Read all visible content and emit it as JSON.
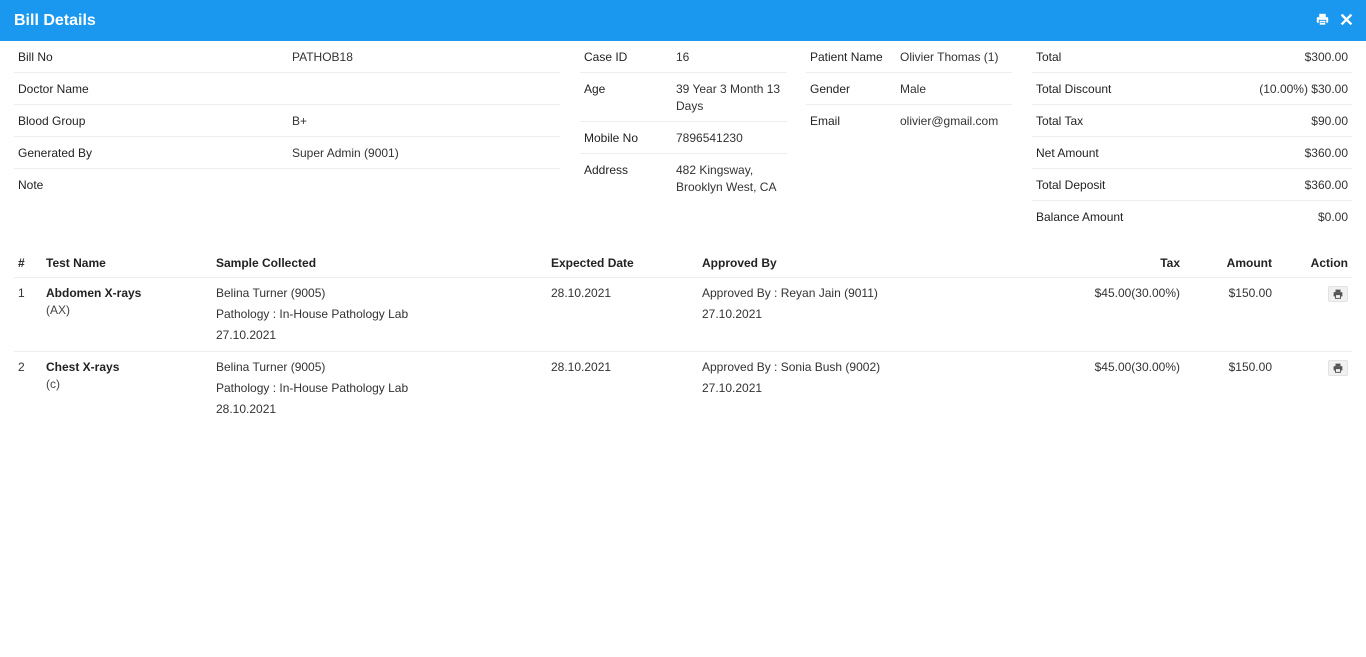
{
  "modal": {
    "title": "Bill Details"
  },
  "icons": {
    "print": "print-icon",
    "close": "close-icon"
  },
  "colors": {
    "header": "#1a98f0"
  },
  "bill_info": [
    {
      "label": "Bill No",
      "value": "PATHOB18"
    },
    {
      "label": "Doctor Name",
      "value": ""
    },
    {
      "label": "Blood Group",
      "value": "B+"
    },
    {
      "label": "Generated By",
      "value": "Super Admin (9001)"
    },
    {
      "label": "Note",
      "value": ""
    }
  ],
  "case_info": [
    {
      "label": "Case ID",
      "value": "16"
    },
    {
      "label": "Age",
      "value": "39 Year 3 Month 13 Days"
    },
    {
      "label": "Mobile No",
      "value": "7896541230"
    },
    {
      "label": "Address",
      "value": "482 Kingsway, Brooklyn West, CA"
    }
  ],
  "patient_info": [
    {
      "label": "Patient Name",
      "value": "Olivier Thomas (1)"
    },
    {
      "label": "Gender",
      "value": "Male"
    },
    {
      "label": "Email",
      "value": "olivier@gmail.com"
    }
  ],
  "totals": [
    {
      "label": "Total",
      "value": "$300.00"
    },
    {
      "label": "Total Discount",
      "value": "(10.00%) $30.00"
    },
    {
      "label": "Total Tax",
      "value": "$90.00"
    },
    {
      "label": "Net Amount",
      "value": "$360.00"
    },
    {
      "label": "Total Deposit",
      "value": "$360.00"
    },
    {
      "label": "Balance Amount",
      "value": "$0.00"
    }
  ],
  "tests": {
    "headers": {
      "num": "#",
      "test_name": "Test Name",
      "sample": "Sample Collected",
      "expected": "Expected Date",
      "approved": "Approved By",
      "tax": "Tax",
      "amount": "Amount",
      "action": "Action"
    },
    "rows": [
      {
        "num": "1",
        "name": "Abdomen X-rays",
        "short": "(AX)",
        "collector": "Belina Turner (9005)",
        "pathology_label": "Pathology :",
        "pathology": "In-House Pathology Lab",
        "collected_date": "27.10.2021",
        "expected": "28.10.2021",
        "approved_label": "Approved By :",
        "approved_by": "Reyan Jain (9011)",
        "approved_date": "27.10.2021",
        "tax": "$45.00(30.00%)",
        "amount": "$150.00"
      },
      {
        "num": "2",
        "name": "Chest X-rays",
        "short": "(c)",
        "collector": "Belina Turner (9005)",
        "pathology_label": "Pathology :",
        "pathology": "In-House Pathology Lab",
        "collected_date": "28.10.2021",
        "expected": "28.10.2021",
        "approved_label": "Approved By :",
        "approved_by": "Sonia Bush (9002)",
        "approved_date": "27.10.2021",
        "tax": "$45.00(30.00%)",
        "amount": "$150.00"
      }
    ]
  }
}
